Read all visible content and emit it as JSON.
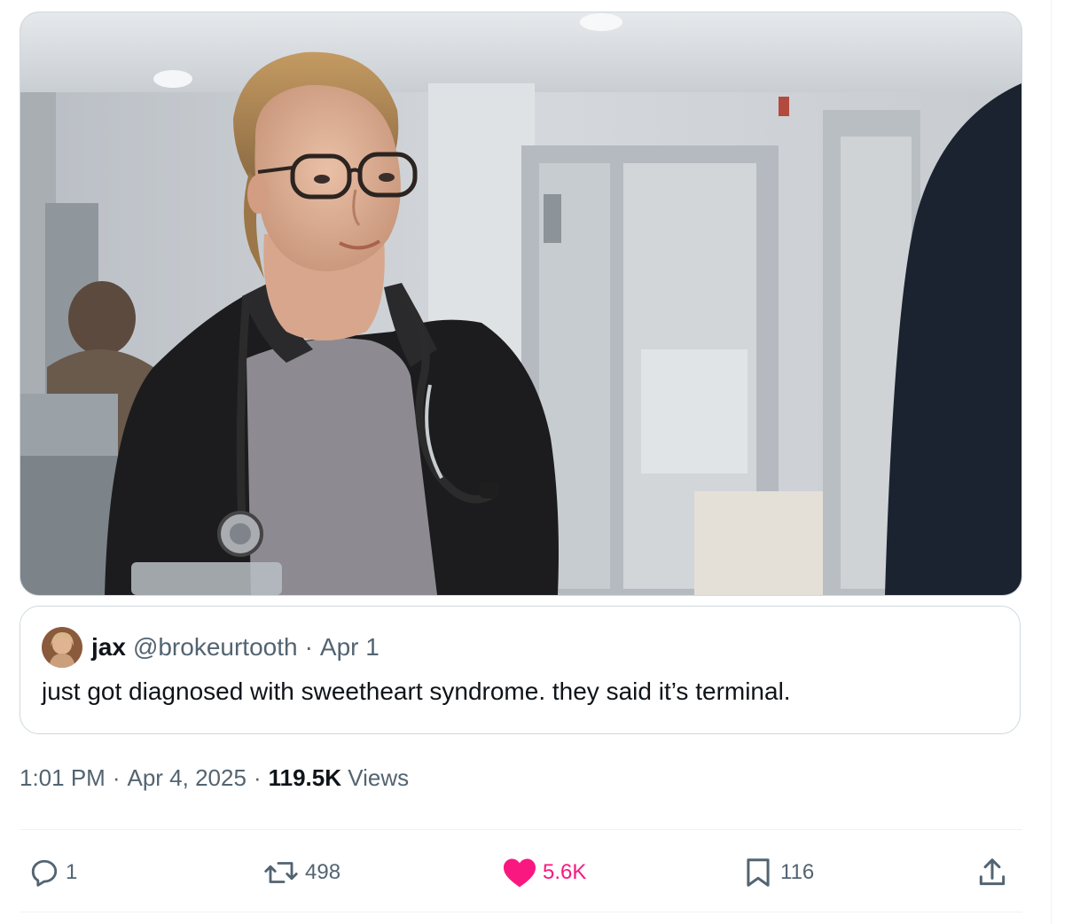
{
  "media": {
    "alt": "",
    "description_icon": "photo"
  },
  "quoted_tweet": {
    "author_name": "jax",
    "author_handle": "@brokeurtooth",
    "separator": "·",
    "date": "Apr 1",
    "text": "just got diagnosed with sweetheart syndrome. they said it’s terminal."
  },
  "meta": {
    "time": "1:01 PM",
    "sep1": "·",
    "date": "Apr 4, 2025",
    "sep2": "·",
    "views_count": "119.5K",
    "views_label": "Views"
  },
  "actions": {
    "reply": {
      "icon": "reply-icon",
      "count": "1"
    },
    "retweet": {
      "icon": "retweet-icon",
      "count": "498"
    },
    "like": {
      "icon": "heart-icon",
      "count": "5.6K",
      "liked": true
    },
    "bookmark": {
      "icon": "bookmark-icon",
      "count": "116"
    },
    "share": {
      "icon": "share-icon"
    }
  },
  "colors": {
    "text": "#0f1419",
    "secondary": "#536471",
    "border": "#cfd9de",
    "like": "#f91880"
  }
}
